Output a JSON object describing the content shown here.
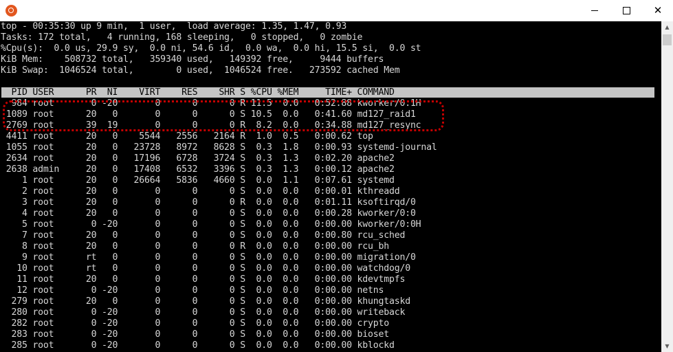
{
  "window": {
    "icon": "ubuntu-icon",
    "controls": {
      "minimize": "minimize-icon",
      "maximize": "maximize-icon",
      "close": "✕"
    }
  },
  "summary": [
    "top - 00:35:30 up 9 min,  1 user,  load average: 1.35, 1.47, 0.93",
    "Tasks: 172 total,   4 running, 168 sleeping,   0 stopped,   0 zombie",
    "%Cpu(s):  0.0 us, 29.9 sy,  0.0 ni, 54.6 id,  0.0 wa,  0.0 hi, 15.5 si,  0.0 st",
    "KiB Mem:    508732 total,   359340 used,   149392 free,     9444 buffers",
    "KiB Swap:  1046524 total,        0 used,  1046524 free.   273592 cached Mem"
  ],
  "table_header": "  PID USER      PR  NI    VIRT    RES    SHR S %CPU %MEM     TIME+ COMMAND",
  "processes": [
    "  984 root       0 -20       0      0      0 R 11.5  0.0   0:52.88 kworker/0:1H",
    " 1089 root      20   0       0      0      0 S 10.5  0.0   0:41.60 md127_raid1",
    " 2769 root      39  19       0      0      0 R  8.2  0.0   0:34.88 md127_resync",
    " 4411 root      20   0    5544   2556   2164 R  1.0  0.5   0:00.62 top",
    " 1055 root      20   0   23728   8972   8628 S  0.3  1.8   0:00.93 systemd-journal",
    " 2634 root      20   0   17196   6728   3724 S  0.3  1.3   0:02.20 apache2",
    " 2638 admin     20   0   17408   6532   3396 S  0.3  1.3   0:00.12 apache2",
    "    1 root      20   0   26664   5836   4660 S  0.0  1.1   0:07.61 systemd",
    "    2 root      20   0       0      0      0 S  0.0  0.0   0:00.01 kthreadd",
    "    3 root      20   0       0      0      0 R  0.0  0.0   0:01.11 ksoftirqd/0",
    "    4 root      20   0       0      0      0 S  0.0  0.0   0:00.28 kworker/0:0",
    "    5 root       0 -20       0      0      0 S  0.0  0.0   0:00.00 kworker/0:0H",
    "    7 root      20   0       0      0      0 S  0.0  0.0   0:00.80 rcu_sched",
    "    8 root      20   0       0      0      0 R  0.0  0.0   0:00.00 rcu_bh",
    "    9 root      rt   0       0      0      0 S  0.0  0.0   0:00.00 migration/0",
    "   10 root      rt   0       0      0      0 S  0.0  0.0   0:00.00 watchdog/0",
    "   11 root      20   0       0      0      0 S  0.0  0.0   0:00.00 kdevtmpfs",
    "   12 root       0 -20       0      0      0 S  0.0  0.0   0:00.00 netns",
    "  279 root      20   0       0      0      0 S  0.0  0.0   0:00.00 khungtaskd",
    "  280 root       0 -20       0      0      0 S  0.0  0.0   0:00.00 writeback",
    "  282 root       0 -20       0      0      0 S  0.0  0.0   0:00.00 crypto",
    "  283 root       0 -20       0      0      0 S  0.0  0.0   0:00.00 bioset",
    "  285 root       0 -20       0      0      0 S  0.0  0.0   0:00.00 kblockd"
  ],
  "colors": {
    "terminal_bg": "#000000",
    "terminal_fg": "#d7d7d7",
    "header_bg": "#c4c4c4",
    "highlight": "#c40000"
  }
}
